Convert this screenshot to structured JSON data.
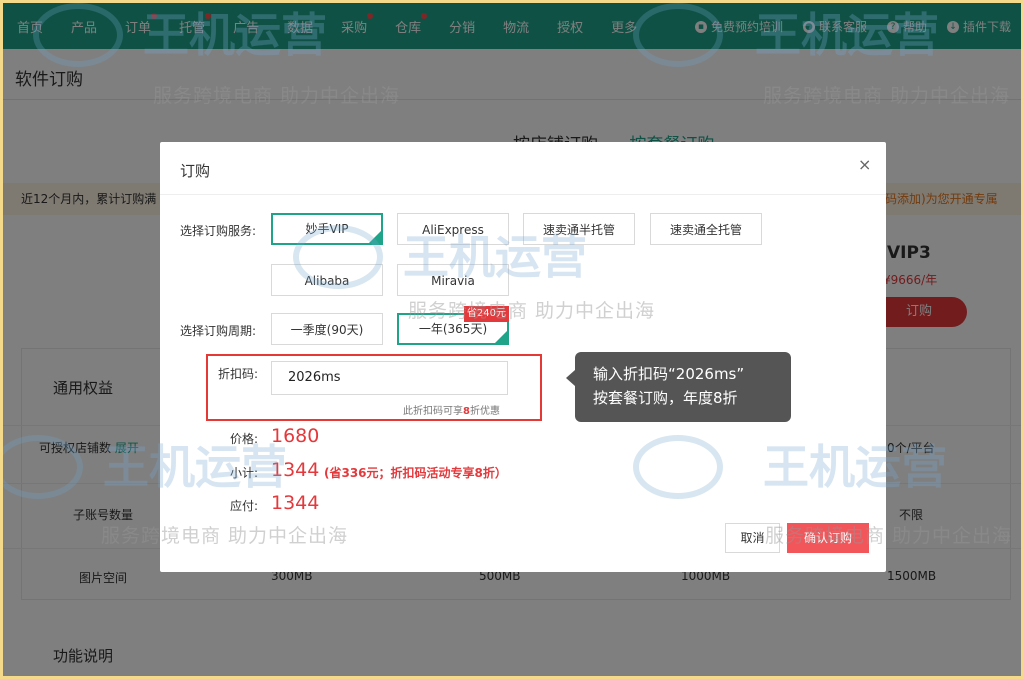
{
  "nav": {
    "items": [
      "首页",
      "产品",
      "订单",
      "托管",
      "广告",
      "数据",
      "采购",
      "仓库",
      "分销",
      "物流",
      "授权",
      "更多"
    ],
    "dots": [
      false,
      false,
      true,
      true,
      false,
      false,
      true,
      true,
      false,
      false,
      false,
      false
    ],
    "right": [
      "免费预约培训",
      "联系客服",
      "帮助",
      "插件下载"
    ]
  },
  "page": {
    "title": "软件订购",
    "tabs": [
      "按店铺订购",
      "按套餐订购"
    ],
    "notice_left": "近12个月内，累计订购满",
    "notice_right": "扫码添加)为您开通专属",
    "plan": {
      "name": "VIP3",
      "price": "¥9666/年",
      "button": "订购"
    },
    "section_general": "通用权益",
    "section_features": "功能说明",
    "rows": [
      {
        "label": "可授权店铺数",
        "link": "展开",
        "last": "0个/平台"
      },
      {
        "label": "子账号数量",
        "last": "不限"
      },
      {
        "label": "图片空间",
        "values": [
          "300MB",
          "500MB",
          "1000MB",
          "1500MB"
        ]
      }
    ]
  },
  "modal": {
    "title": "订购",
    "close": "×",
    "service_label": "选择订购服务:",
    "services": [
      "妙手VIP",
      "AliExpress",
      "速卖通半托管",
      "速卖通全托管",
      "Alibaba",
      "Miravia"
    ],
    "selected_service": "妙手VIP",
    "period_label": "选择订购周期:",
    "periods": [
      "一季度(90天)",
      "一年(365天)"
    ],
    "period_badge": "省240元",
    "code_label": "折扣码:",
    "code_value": "2026ms",
    "code_hint_pre": "此折扣码可享",
    "code_hint_num": "8",
    "code_hint_post": "折优惠",
    "price_label": "价格:",
    "price": "1680",
    "subtotal_label": "小计:",
    "subtotal": "1344",
    "save_note": "(省336元；折扣码活动专享8折）",
    "payable_label": "应付:",
    "payable": "1344",
    "cancel": "取消",
    "confirm": "确认订购"
  },
  "tooltip": {
    "line1": "输入折扣码“2026ms”",
    "line2": "按套餐订购，年度8折"
  },
  "watermark": {
    "brand": "王机运营",
    "slogan": "服务跨境电商 助力中企出海"
  },
  "colors": {
    "primary": "#1fa48a",
    "danger": "#e4393c",
    "outline": "#e53935"
  }
}
